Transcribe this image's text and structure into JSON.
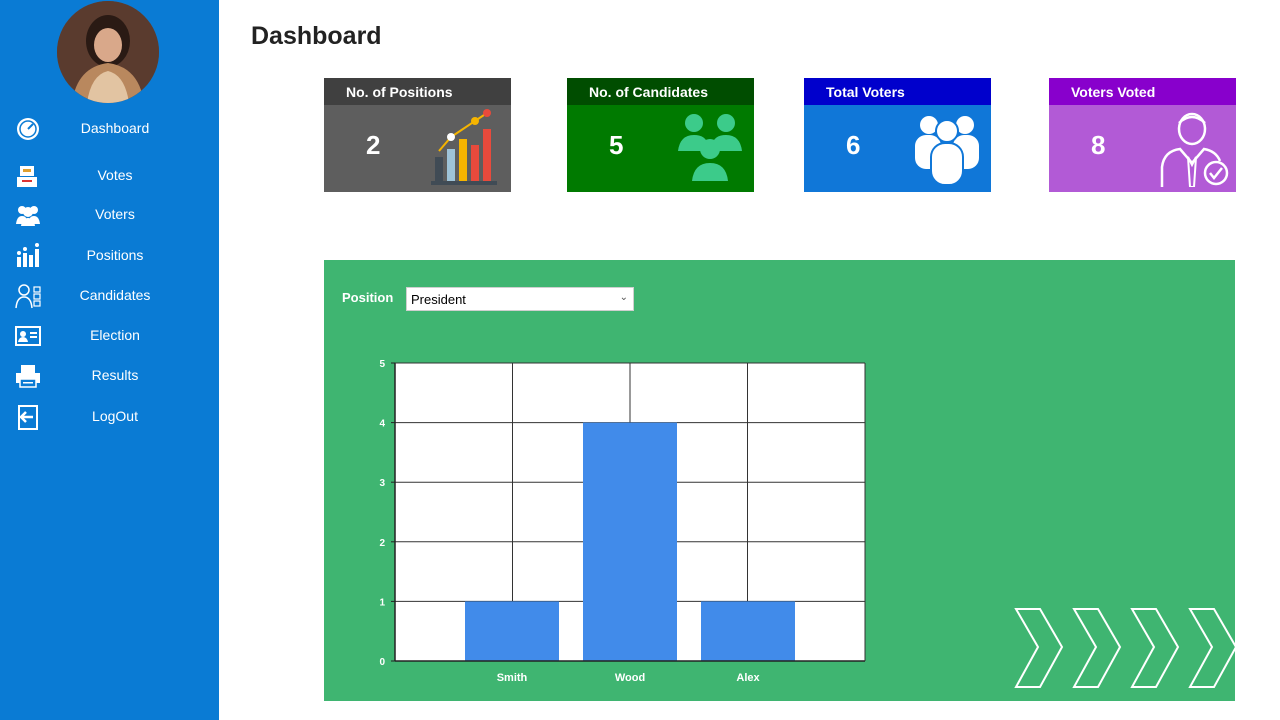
{
  "sidebar": {
    "items": [
      {
        "label": "Dashboard",
        "icon": "dashboard-gauge-icon"
      },
      {
        "label": "Votes",
        "icon": "votes-icon"
      },
      {
        "label": "Voters",
        "icon": "voters-group-icon"
      },
      {
        "label": "Positions",
        "icon": "positions-chart-icon"
      },
      {
        "label": "Candidates",
        "icon": "candidates-icon"
      },
      {
        "label": "Election",
        "icon": "election-card-icon"
      },
      {
        "label": "Results",
        "icon": "results-printer-icon"
      },
      {
        "label": "LogOut",
        "icon": "logout-icon"
      }
    ]
  },
  "header": {
    "title": "Dashboard"
  },
  "cards": [
    {
      "label": "No. of Positions",
      "value": "2",
      "head_color": "#404040",
      "body_color": "#5e5e5e",
      "icon": "bar-chart-icon"
    },
    {
      "label": "No. of Candidates",
      "value": "5",
      "head_color": "#004d00",
      "body_color": "#007a00",
      "icon": "candidates-group-icon"
    },
    {
      "label": "Total Voters",
      "value": "6",
      "head_color": "#0000cc",
      "body_color": "#1077d8",
      "icon": "people-group-icon"
    },
    {
      "label": "Voters Voted",
      "value": "8",
      "head_color": "#8800cc",
      "body_color": "#b25ad6",
      "icon": "voter-check-icon"
    }
  ],
  "filter": {
    "label": "Position",
    "selected": "President"
  },
  "colors": {
    "sidebar": "#0a7bd4",
    "panel": "#3fb571",
    "bar": "#418bea"
  },
  "chart_data": {
    "type": "bar",
    "categories": [
      "Smith",
      "Wood",
      "Alex"
    ],
    "values": [
      1,
      4,
      1
    ],
    "ylim": [
      0,
      5
    ],
    "yticks": [
      0,
      1,
      2,
      3,
      4,
      5
    ],
    "grid": true,
    "xlabel": "",
    "ylabel": ""
  }
}
